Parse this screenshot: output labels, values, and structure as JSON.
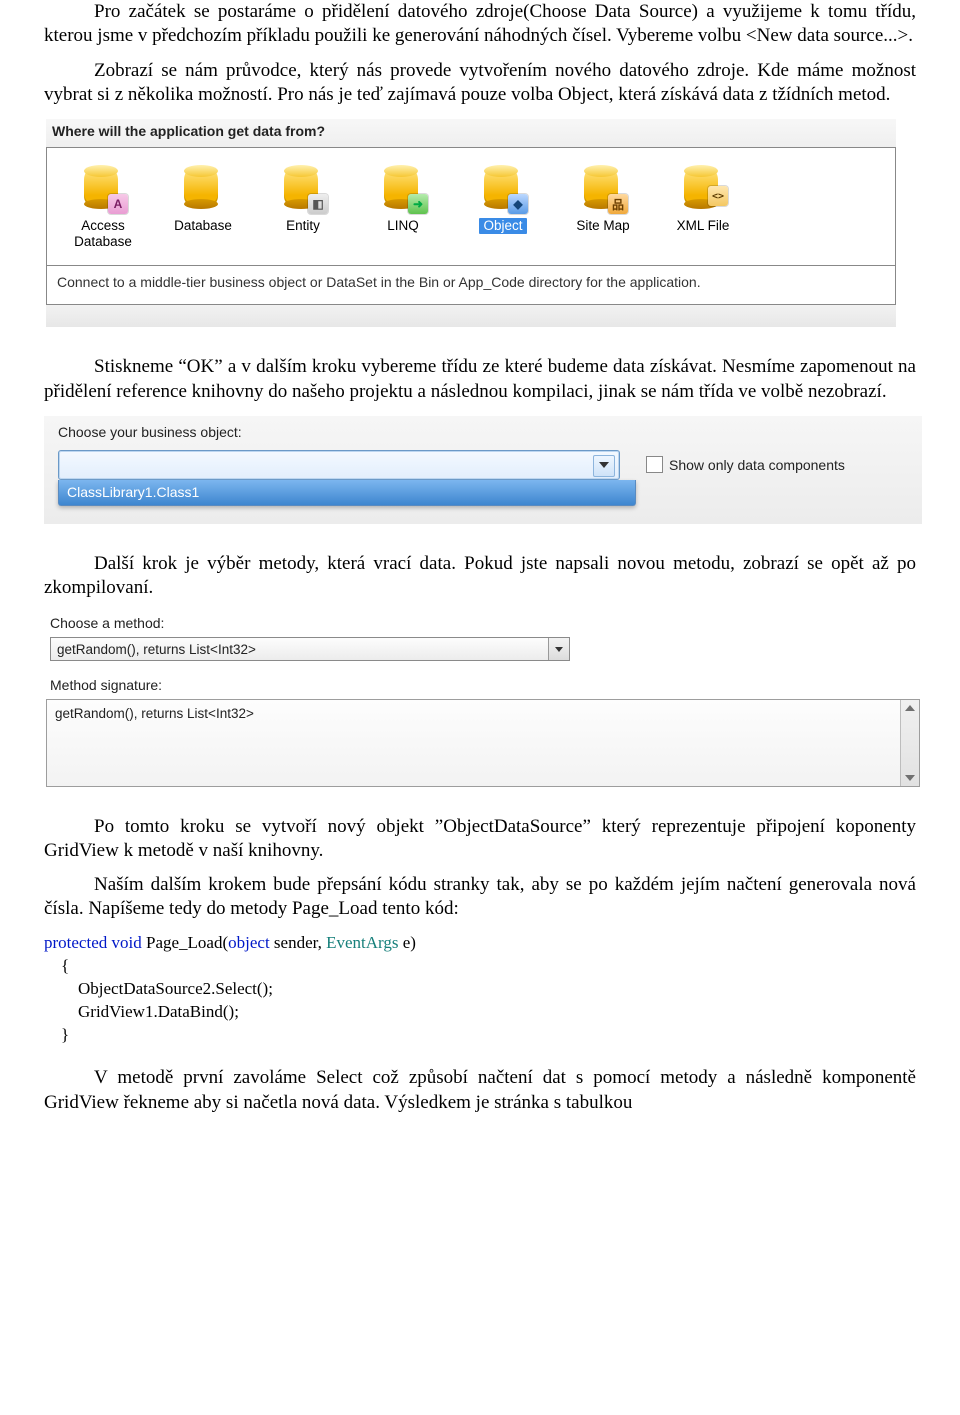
{
  "paragraphs": {
    "p1": "Pro začátek se postaráme o přidělení datového zdroje(Choose Data Source) a využijeme k tomu třídu, kterou jsme v předchozím příkladu použili ke generování náhodných čísel. Vybereme volbu <New data source...>.",
    "p2": "Zobrazí se nám průvodce, který nás provede vytvořením nového datového zdroje. Kde máme možnost vybrat si z několika možností. Pro nás je teď zajímavá pouze volba Object, která získává data z tžídních metod.",
    "p3": "Stiskneme “OK” a v dalším kroku vybereme třídu ze které budeme data získávat. Nesmíme zapomenout na přidělení reference knihovny do našeho projektu a následnou kompilaci, jinak se nám třída ve volbě nezobrazí.",
    "p4": "Další krok je výběr metody, která vrací data. Pokud jste napsali novou metodu, zobrazí se opět až po zkompilovaní.",
    "p5": "Po tomto kroku se vytvoří nový objekt ”ObjectDataSource” který reprezentuje připojení koponenty GridView k metodě v naší knihovny.",
    "p6": "Naším dalším krokem bude přepsání kódu stranky tak, aby se po každém jejím načtení generovala nová čísla. Napíšeme tedy do metody Page_Load tento kód:",
    "p7": "V metodě první zavoláme Select což způsobí načtení dat s pomocí metody a následně komponentě GridView řekneme aby si načetla nová data. Výsledkem je stránka s tabulkou"
  },
  "shot1": {
    "title": "Where will the application get data from?",
    "items": {
      "access": "Access Database",
      "database": "Database",
      "entity": "Entity",
      "linq": "LINQ",
      "object": "Object",
      "sitemap": "Site Map",
      "xml": "XML File"
    },
    "description": "Connect to a middle-tier business object or DataSet in the Bin or App_Code directory for the application."
  },
  "shot2": {
    "label": "Choose your business object:",
    "show_only": "Show only data components",
    "selected": "ClassLibrary1.Class1"
  },
  "shot3": {
    "method_label": "Choose a method:",
    "method_value": "getRandom(), returns List<Int32>",
    "sig_label": "Method signature:",
    "sig_value": "getRandom(), returns List<Int32>"
  },
  "code": {
    "kw_protected": "protected",
    "kw_void": "void",
    "fn": " Page_Load(",
    "kw_object": "object",
    "mid": " sender, ",
    "tp_eventargs": "EventArgs",
    "tail": " e)",
    "l_open": "    {",
    "l1": "        ObjectDataSource2.Select();",
    "l2": "        GridView1.DataBind();",
    "l_close": "    }"
  }
}
